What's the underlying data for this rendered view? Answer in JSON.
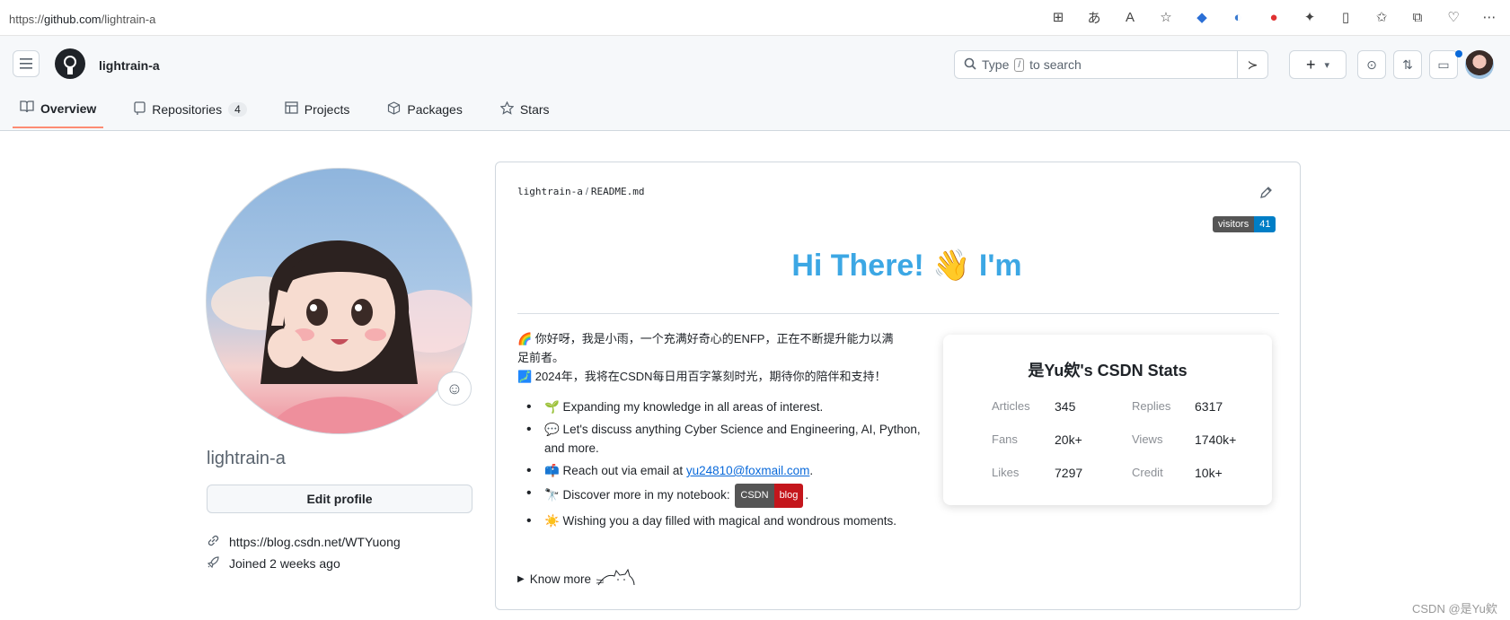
{
  "browser": {
    "url_prefix": "https://",
    "url_host": "github.com",
    "url_path": "/lightrain-a",
    "icons": [
      "grid-icon",
      "translate-icon",
      "read-aloud-icon",
      "favorite-icon",
      "shield-icon",
      "loop-icon",
      "extension-red-icon",
      "puzzle-icon",
      "split-screen-icon",
      "favorites-icon",
      "collections-icon",
      "performance-icon",
      "more-icon"
    ]
  },
  "header": {
    "username": "lightrain-a",
    "search_placeholder_pre": "Type",
    "search_key": "/",
    "search_placeholder_post": "to search",
    "plus_label": "+",
    "caret_label": "▾"
  },
  "tabs": [
    {
      "label": "Overview",
      "icon": "book-icon",
      "active": true
    },
    {
      "label": "Repositories",
      "icon": "repo-icon",
      "count": "4"
    },
    {
      "label": "Projects",
      "icon": "table-icon"
    },
    {
      "label": "Packages",
      "icon": "package-icon"
    },
    {
      "label": "Stars",
      "icon": "star-icon"
    }
  ],
  "profile": {
    "name": "lightrain-a",
    "edit_label": "Edit profile",
    "link": "https://blog.csdn.net/WTYuong",
    "joined": "Joined 2 weeks ago"
  },
  "readme": {
    "path_user": "lightrain-a",
    "path_sep": "/",
    "path_file": "README.md",
    "visitors_label": "visitors",
    "visitors_count": "41",
    "hero": "Hi There! 👋 I'm",
    "intro_line1": "🌈 你好呀，我是小雨，一个充满好奇心的ENFP，正在不断提升能力以满足前者。",
    "intro_line2": "🗾 2024年，我将在CSDN每日用百字篆刻时光，期待你的陪伴和支持！",
    "bullets": [
      {
        "text": "🌱 Expanding my knowledge in all areas of interest."
      },
      {
        "text": "💬 Let's discuss anything Cyber Science and Engineering, AI, Python, and more."
      },
      {
        "pre": "📫 Reach out via email at ",
        "link": "yu24810@foxmail.com",
        "post": "."
      },
      {
        "pre": "🔭 Discover more in my notebook: ",
        "badge_l": "CSDN",
        "badge_r": "blog",
        "post": "."
      },
      {
        "text": "☀️ Wishing you a day filled with magical and wondrous moments."
      }
    ],
    "know_more": "Know more"
  },
  "stats": {
    "title": "是Yu欸's CSDN Stats",
    "rows": [
      {
        "k1": "Articles",
        "v1": "345",
        "k2": "Replies",
        "v2": "6317"
      },
      {
        "k1": "Fans",
        "v1": "20k+",
        "k2": "Views",
        "v2": "1740k+"
      },
      {
        "k1": "Likes",
        "v1": "7297",
        "k2": "Credit",
        "v2": "10k+"
      }
    ]
  },
  "watermark": "CSDN @是Yu欸"
}
